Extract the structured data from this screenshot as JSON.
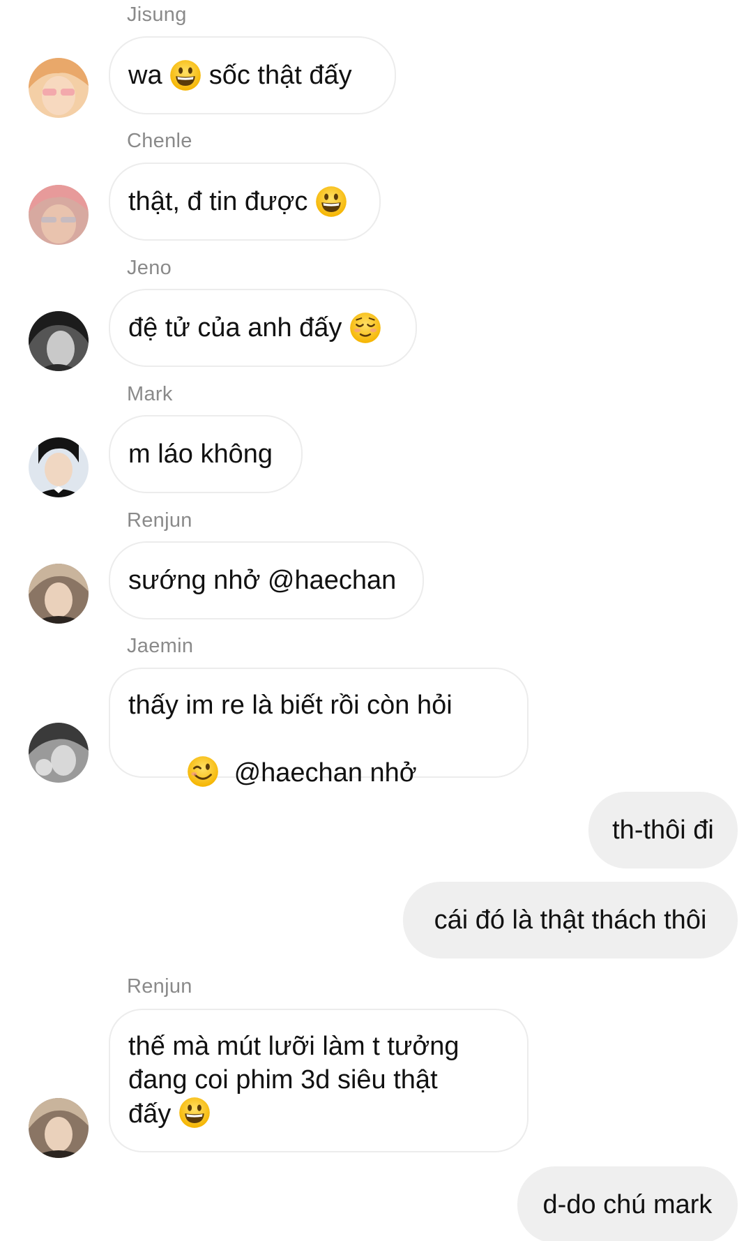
{
  "messages": [
    {
      "sender": "Jisung",
      "parts": [
        "wa ",
        " sốc thật đấy"
      ],
      "emoji": "grinning-face"
    },
    {
      "sender": "Chenle",
      "parts": [
        "thật, đ tin được "
      ],
      "emoji": "grinning-face"
    },
    {
      "sender": "Jeno",
      "parts": [
        "đệ tử của anh đấy "
      ],
      "emoji": "relieved-face"
    },
    {
      "sender": "Mark",
      "parts": [
        "m láo không"
      ]
    },
    {
      "sender": "Renjun",
      "parts": [
        "sướng nhở @haechan"
      ]
    },
    {
      "sender": "Jaemin",
      "line1": "thấy im re là biết rồi còn hỏi",
      "line2": "  @haechan nhở",
      "emoji": "winking-face"
    },
    {
      "outgoing": "th-thôi đi"
    },
    {
      "outgoing": "cái đó là thật thách thôi"
    },
    {
      "sender": "Renjun",
      "line1": "thế mà mút lưỡi làm t tưởng",
      "line2": "đang coi phim 3d siêu thật",
      "line3": "đấy ",
      "emoji": "grinning-face"
    },
    {
      "outgoing": "d-do chú mark"
    }
  ],
  "colors": {
    "incoming_bubble_bg": "#ffffff",
    "incoming_bubble_border": "#ececec",
    "outgoing_bubble_bg": "#efefef",
    "sender_name": "#8a8a8a",
    "text": "#111111"
  }
}
